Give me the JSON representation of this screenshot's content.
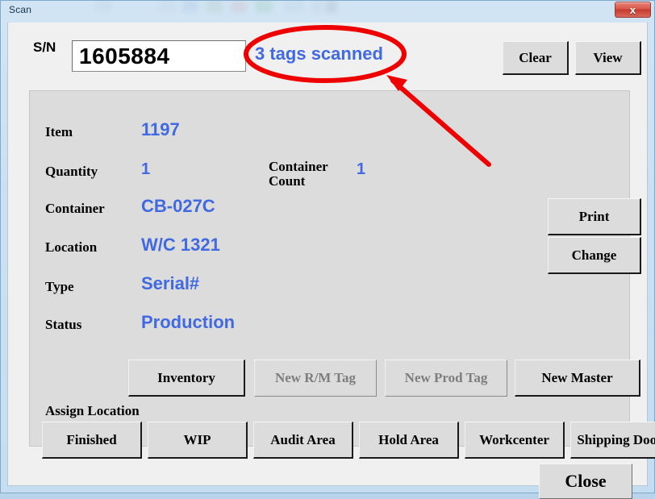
{
  "window": {
    "title": "Scan",
    "close_icon": "close-x-icon",
    "close_label": "x"
  },
  "colors": {
    "value_blue": "#4169E1",
    "annotation_red": "#EE0000",
    "panel_gray": "#DCDCDC",
    "client_bg": "#F0F0F0"
  },
  "header": {
    "sn_label": "S/N",
    "sn_value": "1605884",
    "sn_placeholder": "",
    "status_text": "3 tags scanned",
    "clear_label": "Clear",
    "view_label": "View"
  },
  "fields": [
    {
      "label": "Item",
      "value": "1197"
    },
    {
      "label": "Quantity",
      "value": "1"
    },
    {
      "label": "Container",
      "value": "CB-027C"
    },
    {
      "label": "Location",
      "value": "W/C 1321"
    },
    {
      "label": "Type",
      "value": "Serial#"
    },
    {
      "label": "Status",
      "value": "Production"
    }
  ],
  "container_count": {
    "label_line1": "Container",
    "label_line2": "Count",
    "value": "1"
  },
  "side_buttons": {
    "print_label": "Print",
    "change_label": "Change"
  },
  "action_buttons": [
    {
      "label": "Inventory",
      "enabled": true
    },
    {
      "label": "New R/M Tag",
      "enabled": false
    },
    {
      "label": "New Prod Tag",
      "enabled": false
    },
    {
      "label": "New Master",
      "enabled": true
    }
  ],
  "assign_location": {
    "section_label": "Assign Location",
    "buttons": [
      {
        "label": "Finished"
      },
      {
        "label": "WIP"
      },
      {
        "label": "Audit Area"
      },
      {
        "label": "Hold Area"
      },
      {
        "label": "Workcenter"
      },
      {
        "label": "Shipping Door"
      }
    ]
  },
  "footer": {
    "close_label": "Close"
  },
  "annotations": {
    "ellipse_target": "3 tags scanned",
    "arrow_direction": "up-left"
  }
}
